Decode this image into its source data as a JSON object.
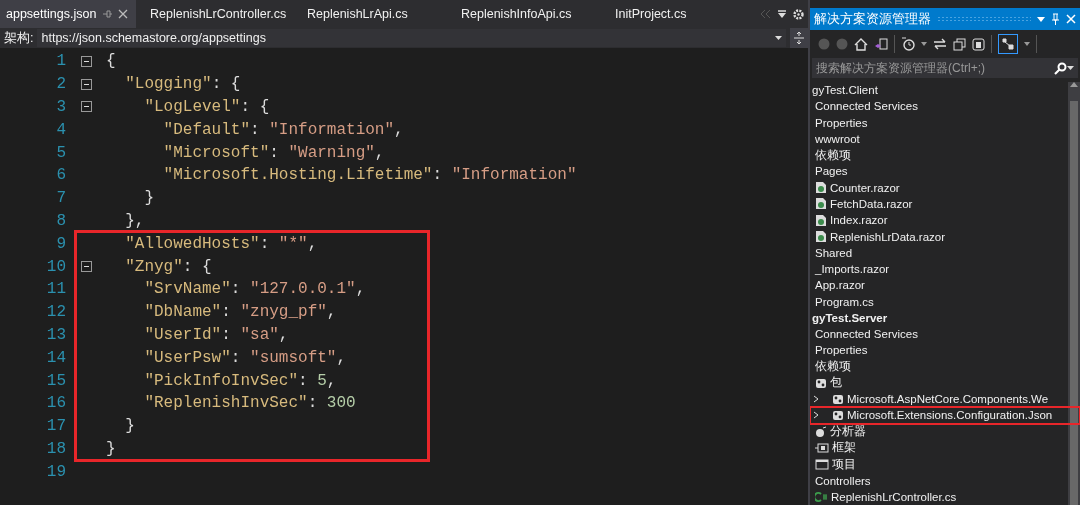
{
  "editor": {
    "tabs": [
      {
        "label": "appsettings.json",
        "selected": true
      },
      {
        "label": "ReplenishLrController.cs",
        "selected": false
      },
      {
        "label": "ReplenishLrApi.cs",
        "selected": false
      },
      {
        "label": "ReplenishInfoApi.cs",
        "selected": false
      },
      {
        "label": "InitProject.cs",
        "selected": false
      }
    ],
    "schema": {
      "label": "架构:",
      "value": "https://json.schemastore.org/appsettings"
    },
    "code_blocks": [
      {
        "highlighted": false,
        "lines": [
          {
            "number": "1",
            "foldable": true,
            "tokens": [
              {
                "kind": "punct",
                "text": "{"
              }
            ]
          },
          {
            "number": "2",
            "foldable": true,
            "tokens": [
              {
                "kind": "key",
                "text": "  \"Logging\""
              },
              {
                "kind": "punct",
                "text": ": {"
              }
            ]
          },
          {
            "number": "3",
            "foldable": true,
            "tokens": [
              {
                "kind": "key",
                "text": "    \"LogLevel\""
              },
              {
                "kind": "punct",
                "text": ": {"
              }
            ]
          },
          {
            "number": "4",
            "foldable": false,
            "tokens": [
              {
                "kind": "key",
                "text": "      \"Default\""
              },
              {
                "kind": "punct",
                "text": ": "
              },
              {
                "kind": "string",
                "text": "\"Information\""
              },
              {
                "kind": "punct",
                "text": ","
              }
            ]
          },
          {
            "number": "5",
            "foldable": false,
            "tokens": [
              {
                "kind": "key",
                "text": "      \"Microsoft\""
              },
              {
                "kind": "punct",
                "text": ": "
              },
              {
                "kind": "string",
                "text": "\"Warning\""
              },
              {
                "kind": "punct",
                "text": ","
              }
            ]
          },
          {
            "number": "6",
            "foldable": false,
            "tokens": [
              {
                "kind": "key",
                "text": "      \"Microsoft.Hosting.Lifetime\""
              },
              {
                "kind": "punct",
                "text": ": "
              },
              {
                "kind": "string",
                "text": "\"Information\""
              }
            ]
          },
          {
            "number": "7",
            "foldable": false,
            "tokens": [
              {
                "kind": "punct",
                "text": "    }"
              }
            ]
          },
          {
            "number": "8",
            "foldable": false,
            "tokens": [
              {
                "kind": "punct",
                "text": "  },"
              }
            ]
          }
        ]
      },
      {
        "highlighted": true,
        "lines": [
          {
            "number": "9",
            "foldable": false,
            "tokens": [
              {
                "kind": "key",
                "text": "  \"AllowedHosts\""
              },
              {
                "kind": "punct",
                "text": ": "
              },
              {
                "kind": "string",
                "text": "\"*\""
              },
              {
                "kind": "punct",
                "text": ","
              }
            ]
          },
          {
            "number": "10",
            "foldable": true,
            "tokens": [
              {
                "kind": "key",
                "text": "  \"Znyg\""
              },
              {
                "kind": "punct",
                "text": ": {"
              }
            ]
          },
          {
            "number": "11",
            "foldable": false,
            "tokens": [
              {
                "kind": "key",
                "text": "    \"SrvName\""
              },
              {
                "kind": "punct",
                "text": ": "
              },
              {
                "kind": "string",
                "text": "\"127.0.0.1\""
              },
              {
                "kind": "punct",
                "text": ","
              }
            ]
          },
          {
            "number": "12",
            "foldable": false,
            "tokens": [
              {
                "kind": "key",
                "text": "    \"DbName\""
              },
              {
                "kind": "punct",
                "text": ": "
              },
              {
                "kind": "string",
                "text": "\"znyg_pf\""
              },
              {
                "kind": "punct",
                "text": ","
              }
            ]
          },
          {
            "number": "13",
            "foldable": false,
            "tokens": [
              {
                "kind": "key",
                "text": "    \"UserId\""
              },
              {
                "kind": "punct",
                "text": ": "
              },
              {
                "kind": "string",
                "text": "\"sa\""
              },
              {
                "kind": "punct",
                "text": ","
              }
            ]
          },
          {
            "number": "14",
            "foldable": false,
            "tokens": [
              {
                "kind": "key",
                "text": "    \"UserPsw\""
              },
              {
                "kind": "punct",
                "text": ": "
              },
              {
                "kind": "string",
                "text": "\"sumsoft\""
              },
              {
                "kind": "punct",
                "text": ","
              }
            ]
          },
          {
            "number": "15",
            "foldable": false,
            "tokens": [
              {
                "kind": "key",
                "text": "    \"PickInfoInvSec\""
              },
              {
                "kind": "punct",
                "text": ": "
              },
              {
                "kind": "number",
                "text": "5"
              },
              {
                "kind": "punct",
                "text": ","
              }
            ]
          },
          {
            "number": "16",
            "foldable": false,
            "tokens": [
              {
                "kind": "key",
                "text": "    \"ReplenishInvSec\""
              },
              {
                "kind": "punct",
                "text": ": "
              },
              {
                "kind": "number",
                "text": "300"
              }
            ]
          },
          {
            "number": "17",
            "foldable": false,
            "tokens": [
              {
                "kind": "punct",
                "text": "  }"
              }
            ]
          },
          {
            "number": "18",
            "foldable": false,
            "tokens": [
              {
                "kind": "punct",
                "text": "}"
              }
            ]
          }
        ]
      },
      {
        "highlighted": false,
        "lines": [
          {
            "number": "19",
            "foldable": false
          }
        ]
      }
    ]
  },
  "solution_explorer": {
    "title": "解决方案资源管理器",
    "search": {
      "placeholder": "搜索解决方案资源管理器(Ctrl+;)"
    },
    "tree": [
      {
        "label": "gyTest.Client",
        "kind": "project",
        "startup": false,
        "children": [
          {
            "label": "Connected Services"
          },
          {
            "label": "Properties"
          },
          {
            "label": "wwwroot"
          },
          {
            "label": "依赖项"
          },
          {
            "label": "Pages",
            "children": [
              {
                "label": "Counter.razor",
                "kind": "razor"
              },
              {
                "label": "FetchData.razor",
                "kind": "razor"
              },
              {
                "label": "Index.razor",
                "kind": "razor"
              },
              {
                "label": "ReplenishLrData.razor",
                "kind": "razor"
              }
            ]
          },
          {
            "label": "Shared"
          },
          {
            "label": "_Imports.razor"
          },
          {
            "label": "App.razor"
          },
          {
            "label": "Program.cs"
          }
        ]
      },
      {
        "label": "gyTest.Server",
        "kind": "project",
        "startup": true,
        "children": [
          {
            "label": "Connected Services"
          },
          {
            "label": "Properties"
          },
          {
            "label": "依赖项",
            "children": [
              {
                "label": "包",
                "kind": "package",
                "children": [
                  {
                    "label": "Microsoft.AspNetCore.Components.We",
                    "kind": "package",
                    "expanded": false,
                    "highlighted": false
                  },
                  {
                    "label": "Microsoft.Extensions.Configuration.Json",
                    "kind": "package",
                    "expanded": false,
                    "highlighted": true
                  }
                ]
              },
              {
                "label": "分析器",
                "kind": "analyzer"
              },
              {
                "label": "框架",
                "kind": "framework"
              },
              {
                "label": "项目",
                "kind": "projects"
              }
            ]
          },
          {
            "label": "Controllers",
            "children": [
              {
                "label": "ReplenishLrController.cs",
                "kind": "csharp"
              }
            ]
          }
        ]
      }
    ]
  }
}
